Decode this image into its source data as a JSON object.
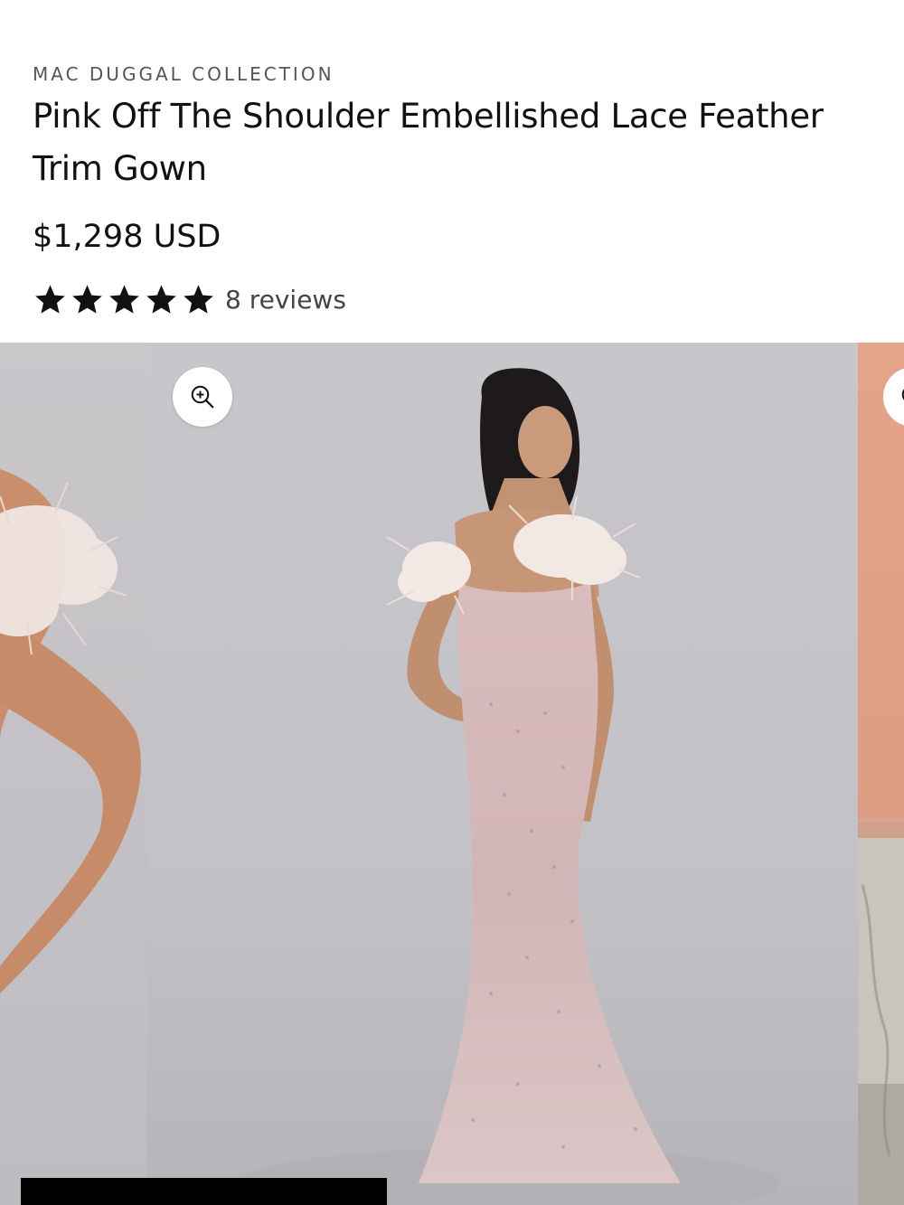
{
  "product": {
    "brand": "MAC DUGGAL COLLECTION",
    "title": "Pink Off The Shoulder Embellished Lace Feather Trim Gown",
    "price": "$1,298 USD",
    "rating": {
      "stars": 5,
      "max_stars": 5,
      "reviews_label": "8 reviews"
    }
  },
  "gallery": {
    "zoom_icon": "zoom-in-icon",
    "colors": {
      "backdrop": "#c5c4c9",
      "gown": "#dcc3c3",
      "feather": "#f0e6e2",
      "next_slide": "#e0a189"
    }
  }
}
